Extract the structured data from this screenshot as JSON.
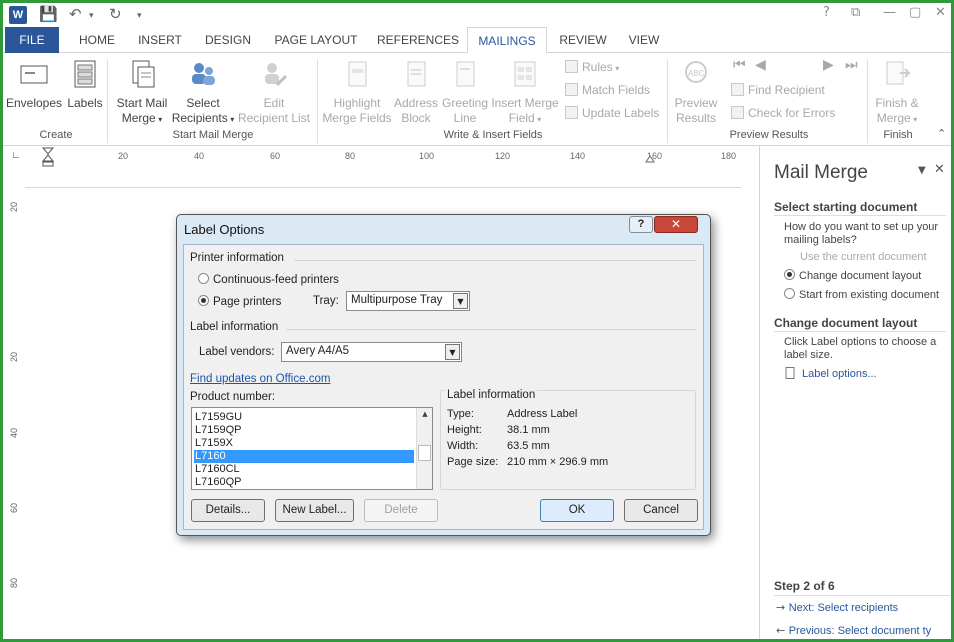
{
  "window": {
    "app_icon": "W",
    "icons": [
      "save-icon",
      "undo-icon",
      "redo-icon",
      "customize-icon",
      "help-icon",
      "ribbon-display-icon",
      "minimize-icon",
      "maximize-icon",
      "close-icon"
    ]
  },
  "tabs": [
    "FILE",
    "HOME",
    "INSERT",
    "DESIGN",
    "PAGE LAYOUT",
    "REFERENCES",
    "MAILINGS",
    "REVIEW",
    "VIEW"
  ],
  "active_tab": "MAILINGS",
  "ribbon": {
    "envelopes": "Envelopes",
    "labels": "Labels",
    "start_mail_merge_1": "Start Mail",
    "start_mail_merge_2": "Merge",
    "select_recipients_1": "Select",
    "select_recipients_2": "Recipients",
    "edit_list_1": "Edit",
    "edit_list_2": "Recipient List",
    "highlight_1": "Highlight",
    "highlight_2": "Merge Fields",
    "address_1": "Address",
    "address_2": "Block",
    "greeting_1": "Greeting",
    "greeting_2": "Line",
    "insert_field_1": "Insert Merge",
    "insert_field_2": "Field",
    "rules": "Rules",
    "match_fields": "Match Fields",
    "update_labels": "Update Labels",
    "preview_1": "Preview",
    "preview_2": "Results",
    "find_recipient": "Find Recipient",
    "check_errors": "Check for Errors",
    "finish_1": "Finish &",
    "finish_2": "Merge",
    "groups": [
      "Create",
      "Start Mail Merge",
      "Write & Insert Fields",
      "Preview Results",
      "Finish"
    ]
  },
  "ruler": {
    "h_ticks": [
      "20",
      "40",
      "60",
      "80",
      "100",
      "120",
      "140",
      "160",
      "180"
    ],
    "v_ticks": [
      "20",
      "20",
      "40",
      "60",
      "80"
    ]
  },
  "pane": {
    "title": "Mail Merge",
    "section1": "Select starting document",
    "question": "How do you want to set up your mailing labels?",
    "opt_current": "Use the current document",
    "opt_change": "Change document layout",
    "opt_existing": "Start from existing document",
    "section2": "Change document layout",
    "instructions": "Click Label options to choose a label size.",
    "label_options_link": "Label options...",
    "step": "Step 2 of 6",
    "next": "Next: Select recipients",
    "previous": "Previous: Select document ty"
  },
  "dialog": {
    "title": "Label Options",
    "help": "?",
    "close": "✕",
    "printer_info": "Printer information",
    "continuous": "Continuous-feed printers",
    "page_printers": "Page printers",
    "tray_label": "Tray:",
    "tray_value": "Multipurpose Tray",
    "label_info": "Label information",
    "vendors_label": "Label vendors:",
    "vendors_value": "Avery A4/A5",
    "find_updates": "Find updates on Office.com",
    "product_number": "Product number:",
    "products": [
      "L7159GU",
      "L7159QP",
      "L7159X",
      "L7160",
      "L7160CL",
      "L7160QP"
    ],
    "selected_product": "L7160",
    "info_title": "Label information",
    "info": [
      {
        "k": "Type:",
        "v": "Address Label"
      },
      {
        "k": "Height:",
        "v": "38.1 mm"
      },
      {
        "k": "Width:",
        "v": "63.5 mm"
      },
      {
        "k": "Page size:",
        "v": "210 mm × 296.9 mm"
      }
    ],
    "details": "Details...",
    "new_label": "New Label...",
    "delete": "Delete",
    "ok": "OK",
    "cancel": "Cancel"
  }
}
